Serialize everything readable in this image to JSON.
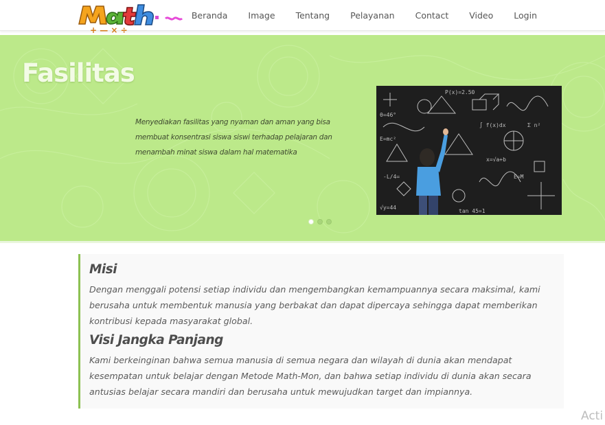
{
  "nav": {
    "items": [
      {
        "label": "Beranda"
      },
      {
        "label": "Image"
      },
      {
        "label": "Tentang"
      },
      {
        "label": "Pelayanan"
      },
      {
        "label": "Contact"
      },
      {
        "label": "Video"
      },
      {
        "label": "Login"
      }
    ]
  },
  "logo": {
    "text": "Math",
    "icon": "math-logo"
  },
  "hero": {
    "title": "Fasilitas",
    "description": "Menyediakan fasilitas yang nyaman dan aman yang bisa membuat konsentrasi siswa siswi terhadap pelajaran dan menambah minat siswa dalam hal matematika",
    "image_icon": "child-at-chalkboard-image",
    "slide_active": 1,
    "slide_count": 3
  },
  "misi": {
    "title": "Misi",
    "text": "Dengan menggali potensi setiap individu dan mengembangkan kemampuannya secara maksimal, kami berusaha untuk membentuk manusia yang berbakat dan dapat dipercaya sehingga dapat memberikan kontribusi kepada masyarakat global."
  },
  "visi": {
    "title": "Visi Jangka Panjang",
    "text": "Kami berkeinginan bahwa semua manusia di semua negara dan wilayah di dunia akan mendapat kesempatan untuk belajar dengan Metode Math-Mon, dan bahwa setiap individu di dunia akan secara antusias belajar secara mandiri dan berusaha untuk mewujudkan target dan impiannya."
  },
  "watermark": "Acti",
  "colors": {
    "hero_bg": "#bce98a",
    "accent_border": "#8cc152",
    "hero_title": "#f3fbe6"
  }
}
